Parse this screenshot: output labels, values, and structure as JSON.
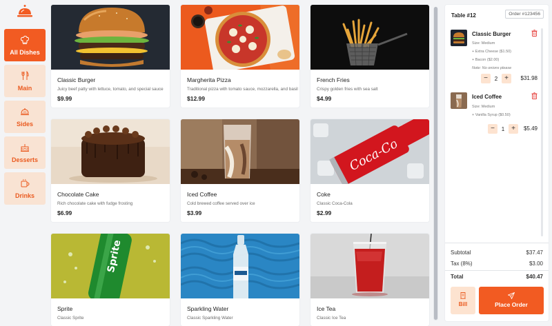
{
  "categories": [
    {
      "label": "All Dishes",
      "icon": "chef-hat-icon"
    },
    {
      "label": "Main",
      "icon": "utensils-icon"
    },
    {
      "label": "Sides",
      "icon": "cloche-icon"
    },
    {
      "label": "Desserts",
      "icon": "cake-icon"
    },
    {
      "label": "Drinks",
      "icon": "mug-icon"
    }
  ],
  "active_category": "All Dishes",
  "products": [
    {
      "name": "Classic Burger",
      "desc": "Juicy beef patty with lettuce, tomato, and special sauce",
      "price": "$9.99"
    },
    {
      "name": "Margherita Pizza",
      "desc": "Traditional pizza with tomato sauce, mozzarella, and basil",
      "price": "$12.99"
    },
    {
      "name": "French Fries",
      "desc": "Crispy golden fries with sea salt",
      "price": "$4.99"
    },
    {
      "name": "Chocolate Cake",
      "desc": "Rich chocolate cake with fudge frosting",
      "price": "$6.99"
    },
    {
      "name": "Iced Coffee",
      "desc": "Cold brewed coffee served over ice",
      "price": "$3.99"
    },
    {
      "name": "Coke",
      "desc": "Classic Coca-Cola",
      "price": "$2.99"
    },
    {
      "name": "Sprite",
      "desc": "Classic Sprite",
      "price": ""
    },
    {
      "name": "Sparkling Water",
      "desc": "Classic Sparkling Water",
      "price": ""
    },
    {
      "name": "Ice Tea",
      "desc": "Classic Ice Tea",
      "price": ""
    }
  ],
  "order": {
    "table": "Table #12",
    "order_no": "Order #123456",
    "items": [
      {
        "name": "Classic Burger",
        "size": "Size: Medium",
        "extras": [
          "+ Extra Cheese ($1.50)",
          "+ Bacon ($2.00)"
        ],
        "note": "Note: No onions please",
        "qty": "2",
        "total": "$31.98"
      },
      {
        "name": "Iced Coffee",
        "size": "Size: Medium",
        "extras": [
          "+ Vanilla Syrup ($0.50)"
        ],
        "note": "",
        "qty": "1",
        "total": "$5.49"
      }
    ],
    "subtotal_label": "Subtotal",
    "subtotal": "$37.47",
    "tax_label": "Tax (8%)",
    "tax": "$3.00",
    "total_label": "Total",
    "total": "$40.47",
    "bill_label": "Bill",
    "place_label": "Place Order"
  },
  "colors": {
    "accent": "#f25b22",
    "accent_light": "#fde3d0"
  }
}
